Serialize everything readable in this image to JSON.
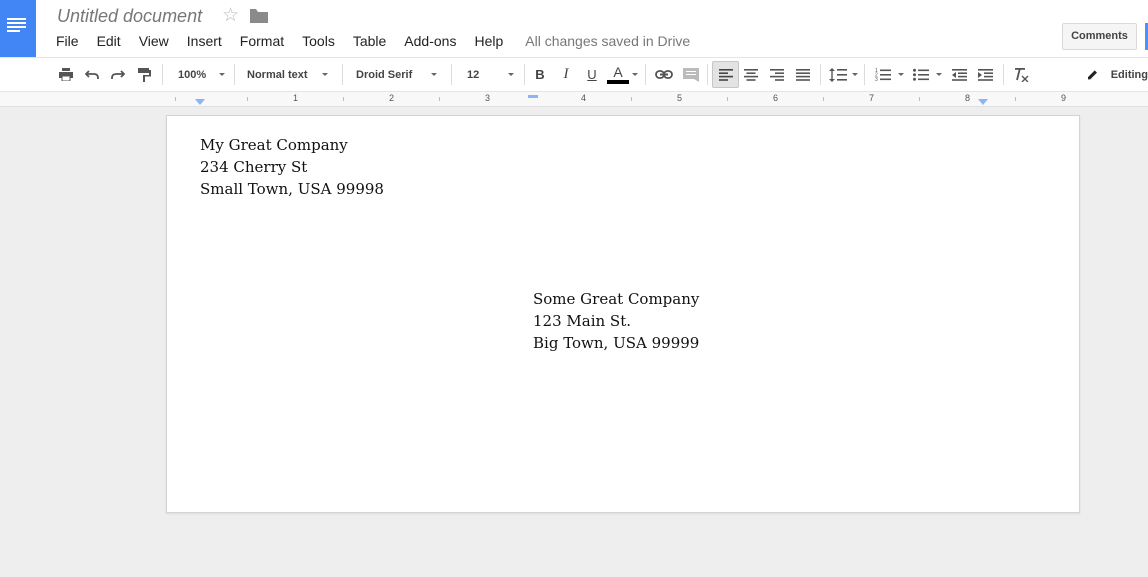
{
  "app": {
    "doc_title": "Untitled document",
    "save_status": "All changes saved in Drive",
    "comments_label": "Comments"
  },
  "menu": [
    "File",
    "Edit",
    "View",
    "Insert",
    "Format",
    "Tools",
    "Table",
    "Add-ons",
    "Help"
  ],
  "toolbar": {
    "zoom": "100%",
    "style": "Normal text",
    "font": "Droid Serif",
    "font_size": "12",
    "bold": "B",
    "italic": "I",
    "underline": "U",
    "text_color": "A",
    "editing_label": "Editing"
  },
  "ruler": [
    "1",
    "2",
    "3",
    "4",
    "5",
    "6",
    "7",
    "8",
    "9"
  ],
  "document": {
    "sender": [
      "My Great Company",
      "234 Cherry St",
      "Small Town, USA 99998"
    ],
    "recipient": [
      "Some Great Company",
      "123 Main St.",
      "Big Town, USA 99999"
    ]
  },
  "colors": {
    "brand": "#4285f4",
    "share_accent": "#4d90fe",
    "text_color_bar": "#000000"
  }
}
